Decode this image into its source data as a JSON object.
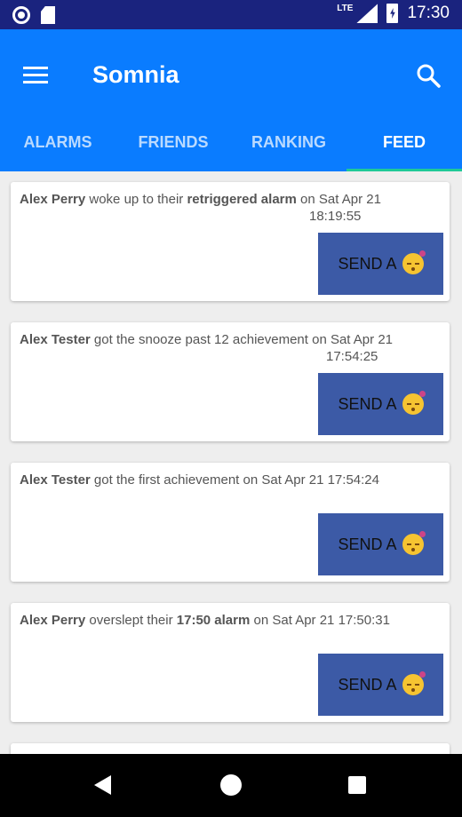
{
  "status_bar": {
    "network": "LTE",
    "time": "17:30"
  },
  "app_bar": {
    "title": "Somnia"
  },
  "tabs": [
    {
      "label": "ALARMS",
      "active": false
    },
    {
      "label": "FRIENDS",
      "active": false
    },
    {
      "label": "RANKING",
      "active": false
    },
    {
      "label": "FEED",
      "active": true
    }
  ],
  "feed": [
    {
      "user": "Alex Perry",
      "text1": " woke up to their ",
      "bold2": "retriggered alarm",
      "text2": " on Sat Apr 21",
      "line2": "18:19:55",
      "button": "SEND A"
    },
    {
      "user": "Alex Tester",
      "text1": " got the snooze past 12 achievement on Sat Apr 21",
      "bold2": "",
      "text2": "",
      "line2": "17:54:25",
      "button": "SEND A"
    },
    {
      "user": "Alex Tester",
      "text1": " got the first achievement on Sat Apr 21 17:54:24",
      "bold2": "",
      "text2": "",
      "line2": "",
      "button": "SEND A"
    },
    {
      "user": "Alex Perry",
      "text1": " overslept their ",
      "bold2": "17:50 alarm",
      "text2": " on Sat Apr 21 17:50:31",
      "line2": "",
      "button": "SEND A"
    }
  ],
  "colors": {
    "app_bar": "#0a7cff",
    "status_bar": "#1a237e",
    "button": "#3c5aa6",
    "tab_indicator": "#20c997"
  },
  "icons": {
    "menu": "hamburger-menu-icon",
    "search": "search-icon",
    "emoji": "sleeping-face-emoji-icon"
  }
}
